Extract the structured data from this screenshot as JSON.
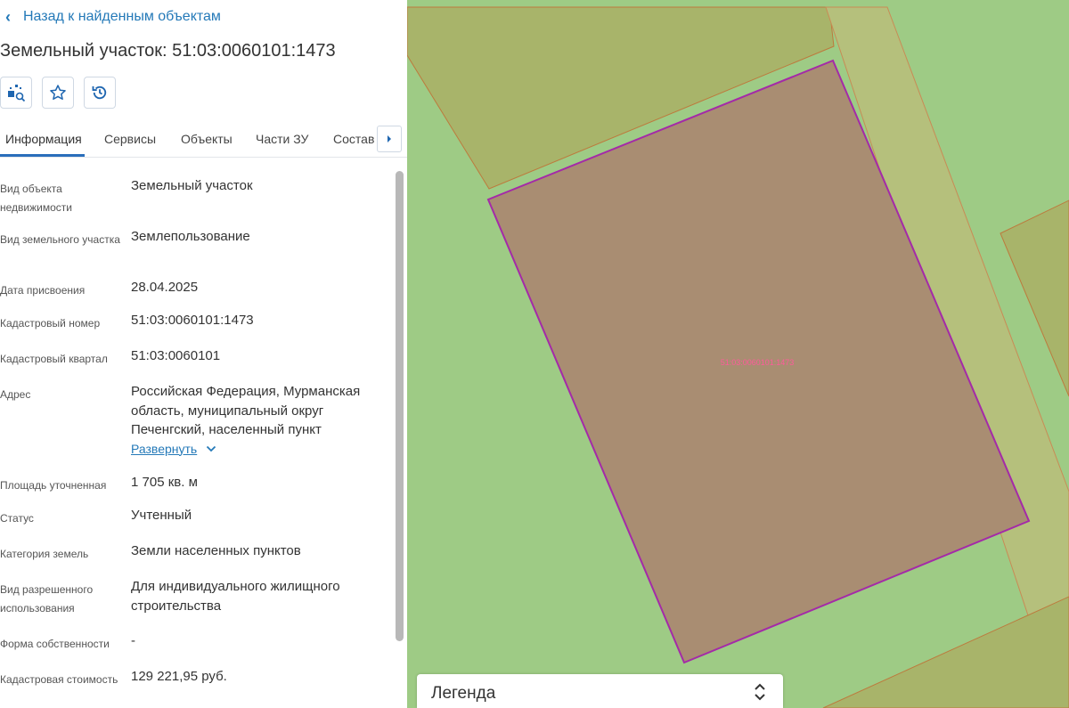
{
  "back_link": "Назад к найденным объектам",
  "title": "Земельный участок: 51:03:0060101:1473",
  "toolbar": {
    "icons": [
      "map-search-icon",
      "star-icon",
      "history-icon"
    ]
  },
  "tabs": [
    {
      "label": "Информация",
      "active": true
    },
    {
      "label": "Сервисы",
      "active": false
    },
    {
      "label": "Объекты",
      "active": false
    },
    {
      "label": "Части ЗУ",
      "active": false
    },
    {
      "label": "Состав",
      "active": false
    }
  ],
  "info": [
    {
      "label": "Вид объекта недвижимости",
      "value": "Земельный участок"
    },
    {
      "label": "Вид земельного участка",
      "value": "Землепользование"
    },
    {
      "label": "Дата присвоения",
      "value": "28.04.2025"
    },
    {
      "label": "Кадастровый номер",
      "value": "51:03:0060101:1473"
    },
    {
      "label": "Кадастровый квартал",
      "value": "51:03:0060101"
    },
    {
      "label": "Адрес",
      "value": "Российская Федерация, Мурманская область, муниципальный округ Печенгский, населенный пункт"
    },
    {
      "label": "Площадь уточненная",
      "value": "1 705 кв. м"
    },
    {
      "label": "Статус",
      "value": "Учтенный"
    },
    {
      "label": "Категория земель",
      "value": "Земли населенных пунктов"
    },
    {
      "label": "Вид разрешенного использования",
      "value": "Для индивидуального жилищного строительства"
    },
    {
      "label": "Форма собственности",
      "value": "-"
    },
    {
      "label": "Кадастровая стоимость",
      "value": "129 221,95 руб."
    }
  ],
  "address_expand": "Развернуть",
  "map": {
    "parcel_label": "51:03:0060101:1473",
    "colors": {
      "background": "#9ecb85",
      "olive": "#a8b46a",
      "strip": "#b5c07c",
      "parcel": "#a98d72",
      "parcel_border": "#a42aa8"
    }
  },
  "legend": {
    "title": "Легенда"
  }
}
